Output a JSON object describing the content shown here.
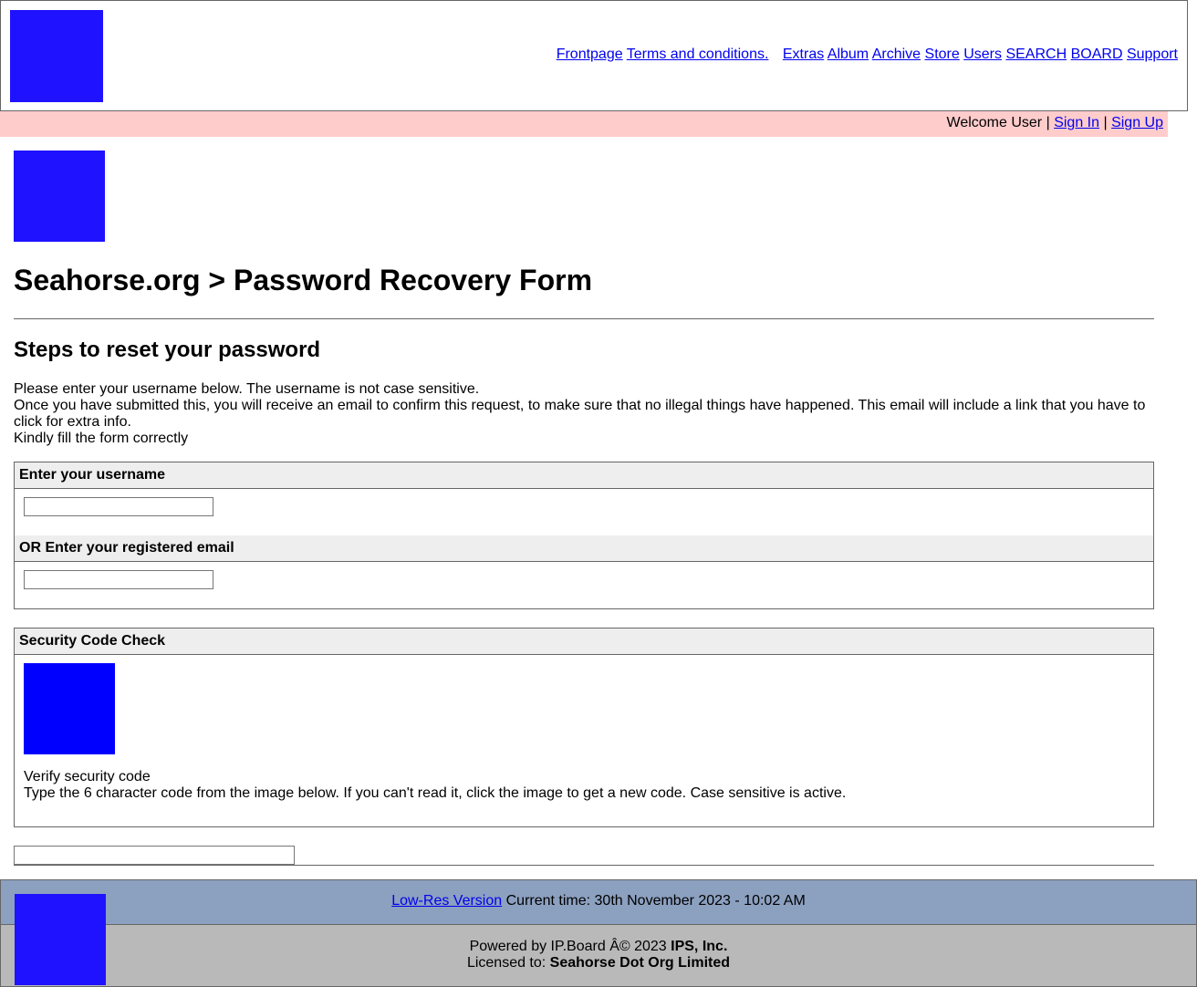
{
  "colors": {
    "logo_blue": "#1f12ff",
    "captcha_blue": "#0000ff",
    "welcome_bar": "#ffcccc",
    "section_header": "#eeeeee",
    "footer_top": "#8ca0c0",
    "footer_bottom": "#b9b9b9",
    "link": "#0000ee"
  },
  "header": {
    "nav_left": [
      "Frontpage",
      "Terms and conditions."
    ],
    "nav_right": [
      "Extras",
      "Album",
      "Archive",
      "Store",
      "Users",
      "SEARCH",
      "BOARD",
      "Support"
    ]
  },
  "welcome": {
    "text": "Welcome User",
    "sep": "|",
    "sign_in": "Sign In",
    "sign_up": "Sign Up"
  },
  "main": {
    "title": "Seahorse.org > Password Recovery Form",
    "steps_title": "Steps to reset your password",
    "intro_lines": [
      "Please enter your username below. The username is not case sensitive.",
      "Once you have submitted this, you will receive an email to confirm this request, to make sure that no illegal things have happened. This email will include a link that you have to click for extra info.",
      "Kindly fill the form correctly"
    ],
    "username_label": "Enter your username",
    "email_label": "OR Enter your registered email",
    "security_label": "Security Code Check",
    "verify_title": "Verify security code",
    "verify_text": "Type the 6 character code from the image below. If you can't read it, click the image to get a new code. Case sensitive is active."
  },
  "footer": {
    "lowres_link": "Low-Res Version",
    "time_text": "Current time: 30th November 2023 - 10:02 AM",
    "powered_text": "Powered by IP.Board Â© 2023",
    "powered_company": "IPS, Inc.",
    "licensed_text": "Licensed to:",
    "licensed_company": "Seahorse Dot Org Limited"
  }
}
